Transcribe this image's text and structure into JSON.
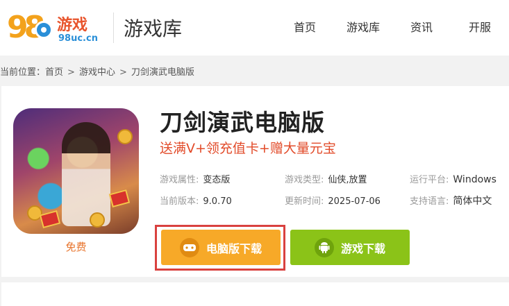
{
  "header": {
    "logo_digits": "98",
    "logo_text": "游戏",
    "logo_domain": "98uc.cn",
    "site_title": "游戏库",
    "nav": [
      {
        "label": "首页"
      },
      {
        "label": "游戏库"
      },
      {
        "label": "资讯"
      },
      {
        "label": "开服"
      }
    ]
  },
  "breadcrumb": {
    "prefix": "当前位置：",
    "items": [
      "首页",
      "游戏中心",
      "刀剑演武电脑版"
    ],
    "separator": ">"
  },
  "game": {
    "title": "刀剑演武电脑版",
    "promo": "送满V+领充值卡+赠大量元宝",
    "price_label": "免费",
    "info": [
      [
        {
          "key": "游戏属性:",
          "value": "变态版"
        },
        {
          "key": "游戏类型:",
          "value": "仙侠,放置"
        },
        {
          "key": "运行平台:",
          "value": "Windows"
        }
      ],
      [
        {
          "key": "当前版本:",
          "value": "9.0.70"
        },
        {
          "key": "更新时间:",
          "value": "2025-07-06"
        },
        {
          "key": "支持语言:",
          "value": "简体中文"
        }
      ]
    ]
  },
  "buttons": {
    "pc_download": "电脑版下载",
    "mobile_download": "游戏下载"
  },
  "icons": {
    "pc": "gamepad-icon",
    "mobile": "android-icon"
  },
  "colors": {
    "pc_button": "#f7a928",
    "mobile_button": "#8bc318",
    "highlight_border": "#d9413f",
    "promo": "#e24b2a",
    "free": "#e8742c"
  }
}
